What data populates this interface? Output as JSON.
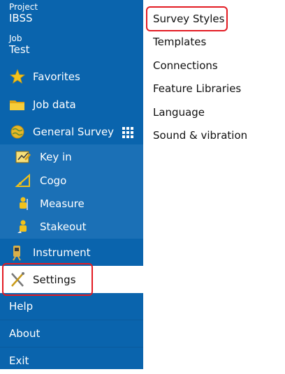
{
  "sidebar": {
    "project": {
      "label": "Project",
      "value": "IBSS"
    },
    "job": {
      "label": "Job",
      "value": "Test"
    },
    "items": [
      {
        "label": "Favorites",
        "icon": "star-icon"
      },
      {
        "label": "Job data",
        "icon": "folder-icon"
      },
      {
        "label": "General Survey",
        "icon": "globe-icon",
        "action_icon": "grid-menu-icon"
      },
      {
        "label": "Key in",
        "icon": "key-in-icon"
      },
      {
        "label": "Cogo",
        "icon": "cogo-icon"
      },
      {
        "label": "Measure",
        "icon": "measure-icon"
      },
      {
        "label": "Stakeout",
        "icon": "stakeout-icon"
      },
      {
        "label": "Instrument",
        "icon": "instrument-icon"
      },
      {
        "label": "Settings",
        "icon": "settings-icon",
        "active": true
      },
      {
        "label": "Help"
      },
      {
        "label": "About"
      },
      {
        "label": "Exit"
      }
    ]
  },
  "settings_menu": {
    "items": [
      "Survey Styles",
      "Templates",
      "Connections",
      "Feature Libraries",
      "Language",
      "Sound & vibration"
    ]
  },
  "colors": {
    "sidebar_bg": "#0a64ad",
    "sub_item_bg": "#1b70b6",
    "highlight": "#e31b23",
    "icon_gold": "#f2c21b"
  }
}
